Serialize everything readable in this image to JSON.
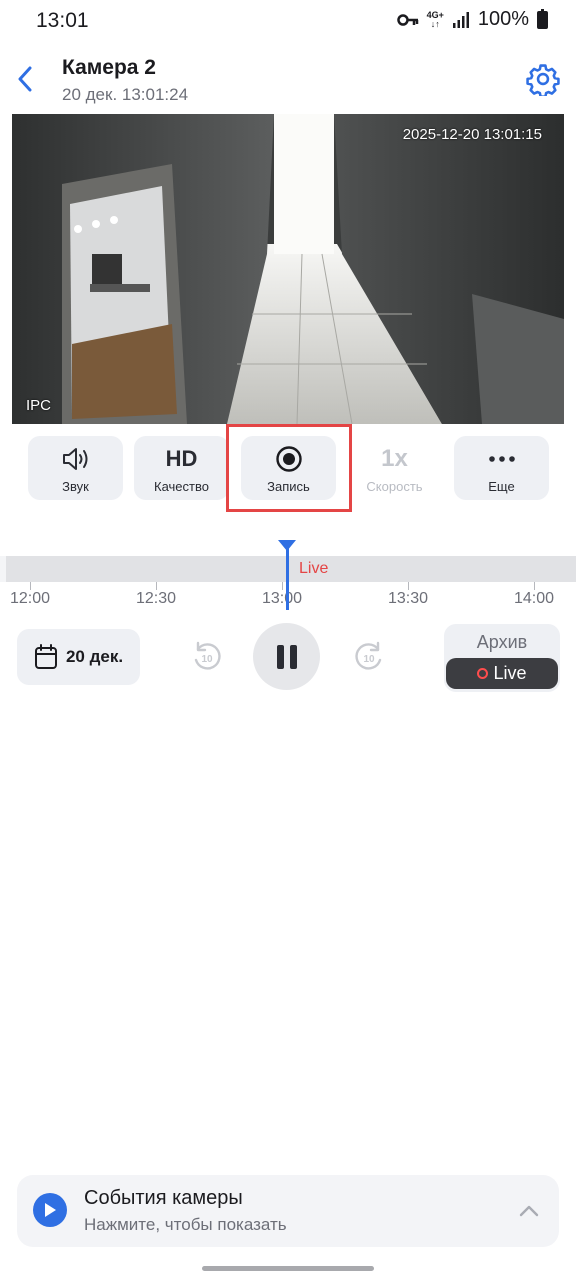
{
  "status_bar": {
    "time": "13:01",
    "network_top": "4G+",
    "network_bottom": "↓↑",
    "battery": "100%"
  },
  "header": {
    "title": "Камера 2",
    "subtitle": "20 дек. 13:01:24"
  },
  "video": {
    "timestamp": "2025-12-20 13:01:15",
    "watermark": "IPC"
  },
  "controls": [
    {
      "icon": "speaker-icon",
      "label": "Звук"
    },
    {
      "icon": "hd-icon",
      "text": "HD",
      "label": "Качество"
    },
    {
      "icon": "record-icon",
      "label": "Запись"
    },
    {
      "icon": "speed-icon",
      "text": "1x",
      "label": "Скорость"
    },
    {
      "icon": "more-icon",
      "label": "Еще"
    }
  ],
  "timeline": {
    "live_label": "Live",
    "ticks": [
      "12:00",
      "12:30",
      "13:00",
      "13:30",
      "14:00"
    ]
  },
  "playback": {
    "date_label": "20 дек.",
    "skip_back_seconds": "10",
    "skip_forward_seconds": "10"
  },
  "mode": {
    "archive_label": "Архив",
    "live_label": "Live"
  },
  "events": {
    "title": "События камеры",
    "subtitle": "Нажмите, чтобы показать"
  },
  "colors": {
    "accent": "#2f6fe3",
    "live_red": "#e44545",
    "highlight": "#e44545"
  }
}
